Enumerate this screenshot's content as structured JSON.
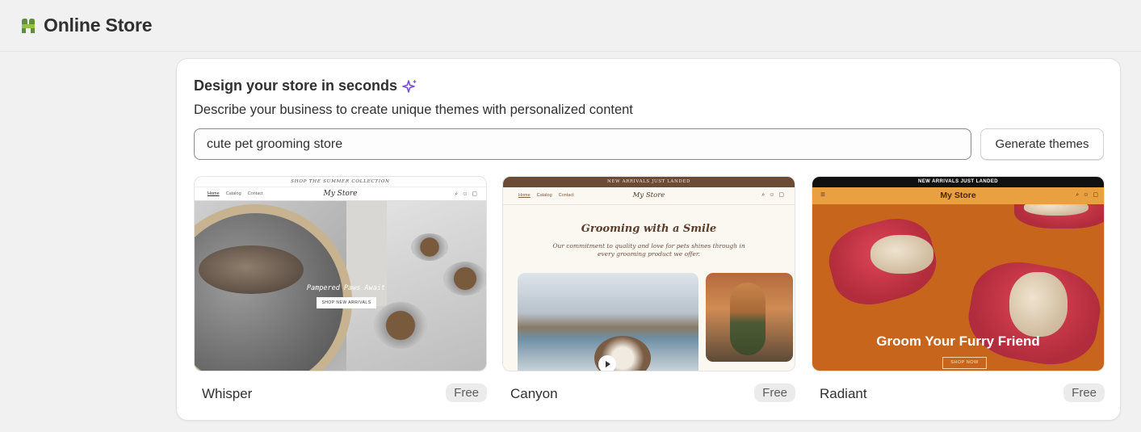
{
  "app": {
    "title": "Online Store",
    "logo_icon": "shopify-bag-icon",
    "logo_color": "#5e8e3e"
  },
  "designer": {
    "heading": "Design your store in seconds",
    "heading_icon": "sparkle-icon",
    "subtitle": "Describe your business to create unique themes with personalized content",
    "prompt_value": "cute pet grooming store",
    "generate_label": "Generate themes"
  },
  "themes": [
    {
      "name": "Whisper",
      "price": "Free",
      "preview": {
        "announcement": "SHOP THE SUMMER COLLECTION",
        "nav_links": [
          "Home",
          "Catalog",
          "Contact"
        ],
        "brand": "My Store",
        "hero_text": "Pampered Paws Await",
        "cta": "SHOP NEW ARRIVALS"
      }
    },
    {
      "name": "Canyon",
      "price": "Free",
      "preview": {
        "announcement": "NEW ARRIVALS JUST LANDED",
        "nav_links": [
          "Home",
          "Catalog",
          "Contact"
        ],
        "brand": "My Store",
        "heading": "Grooming with a Smile",
        "text": "Our commitment to quality and love for pets shines through in every grooming product we offer."
      }
    },
    {
      "name": "Radiant",
      "price": "Free",
      "preview": {
        "announcement": "NEW ARRIVALS JUST LANDED",
        "brand": "My Store",
        "hero_text": "Groom Your Furry Friend",
        "cta": "SHOP NOW"
      }
    }
  ]
}
